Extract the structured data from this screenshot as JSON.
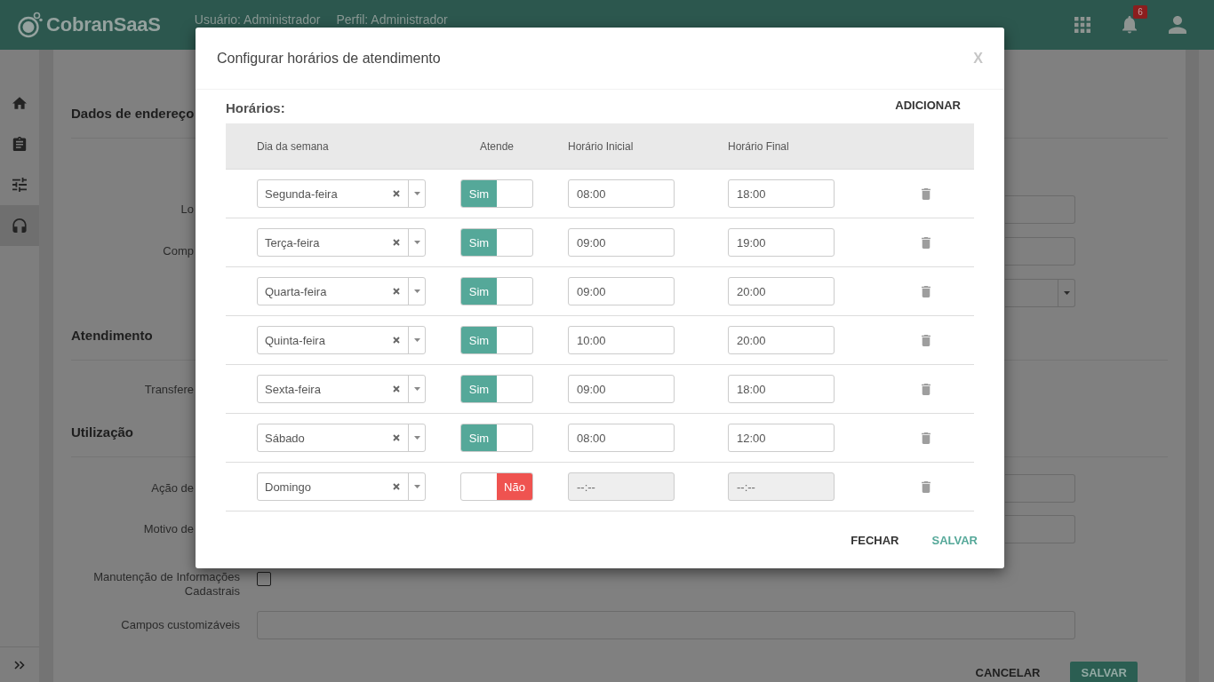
{
  "header": {
    "brand": "CobranSaaS",
    "user": "Usuário: Administrador",
    "profile": "Perfil: Administrador",
    "notification_count": "6"
  },
  "sidebar": {
    "items": [
      {
        "selected": false
      },
      {
        "selected": false
      },
      {
        "selected": false
      },
      {
        "selected": true
      }
    ]
  },
  "form": {
    "sections": [
      {
        "title": "Dados de endereço",
        "rows": [
          {
            "label": "Lo",
            "covered": true,
            "kind": "input"
          },
          {
            "label": "Comp",
            "covered": true,
            "kind": "input"
          },
          {
            "covered": true,
            "kind": "select"
          }
        ]
      },
      {
        "title": "Atendimento",
        "rows": [
          {
            "label": "Transfere",
            "covered": true
          }
        ]
      },
      {
        "title": "Utilização",
        "rows": [
          {
            "label": "Ação de",
            "covered": true,
            "kind": "input"
          },
          {
            "label": "Motivo de",
            "covered": true,
            "kind": "input"
          },
          {
            "label": "Manutenção de Informações Cadastrais",
            "covered": false,
            "kind": "checkbox",
            "checked": false
          },
          {
            "label": "Campos customizáveis",
            "covered": false,
            "kind": "input"
          }
        ]
      }
    ],
    "buttons": [
      {
        "label": "CANCELAR",
        "kind": "text"
      },
      {
        "label": "SALVAR",
        "kind": "primary"
      }
    ]
  },
  "dialog": {
    "title": "Configurar horários de atendimento",
    "close": "X",
    "section_label": "Horários:",
    "add_button": "ADICIONAR",
    "columns": [
      "Dia da semana",
      "Atende",
      "Horário Inicial",
      "Horário Final"
    ],
    "rows": [
      {
        "day": "Segunda-feira",
        "attends": true,
        "attend_label": "Sim",
        "start": {
          "value": "08:00",
          "disabled": false
        },
        "end": {
          "value": "18:00",
          "disabled": false
        }
      },
      {
        "day": "Terça-feira",
        "attends": true,
        "attend_label": "Sim",
        "start": {
          "value": "09:00",
          "disabled": false
        },
        "end": {
          "value": "19:00",
          "disabled": false
        }
      },
      {
        "day": "Quarta-feira",
        "attends": true,
        "attend_label": "Sim",
        "start": {
          "value": "09:00",
          "disabled": false
        },
        "end": {
          "value": "20:00",
          "disabled": false
        }
      },
      {
        "day": "Quinta-feira",
        "attends": true,
        "attend_label": "Sim",
        "start": {
          "value": "10:00",
          "disabled": false
        },
        "end": {
          "value": "20:00",
          "disabled": false
        }
      },
      {
        "day": "Sexta-feira",
        "attends": true,
        "attend_label": "Sim",
        "start": {
          "value": "09:00",
          "disabled": false
        },
        "end": {
          "value": "18:00",
          "disabled": false
        }
      },
      {
        "day": "Sábado",
        "attends": true,
        "attend_label": "Sim",
        "start": {
          "value": "08:00",
          "disabled": false
        },
        "end": {
          "value": "12:00",
          "disabled": false
        }
      },
      {
        "day": "Domingo",
        "attends": false,
        "attend_label": "Não",
        "start": {
          "placeholder": "--:--",
          "disabled": true
        },
        "end": {
          "placeholder": "--:--",
          "disabled": true
        }
      }
    ],
    "buttons": [
      {
        "label": "FECHAR",
        "kind": "default"
      },
      {
        "label": "SALVAR",
        "kind": "primary"
      }
    ]
  }
}
